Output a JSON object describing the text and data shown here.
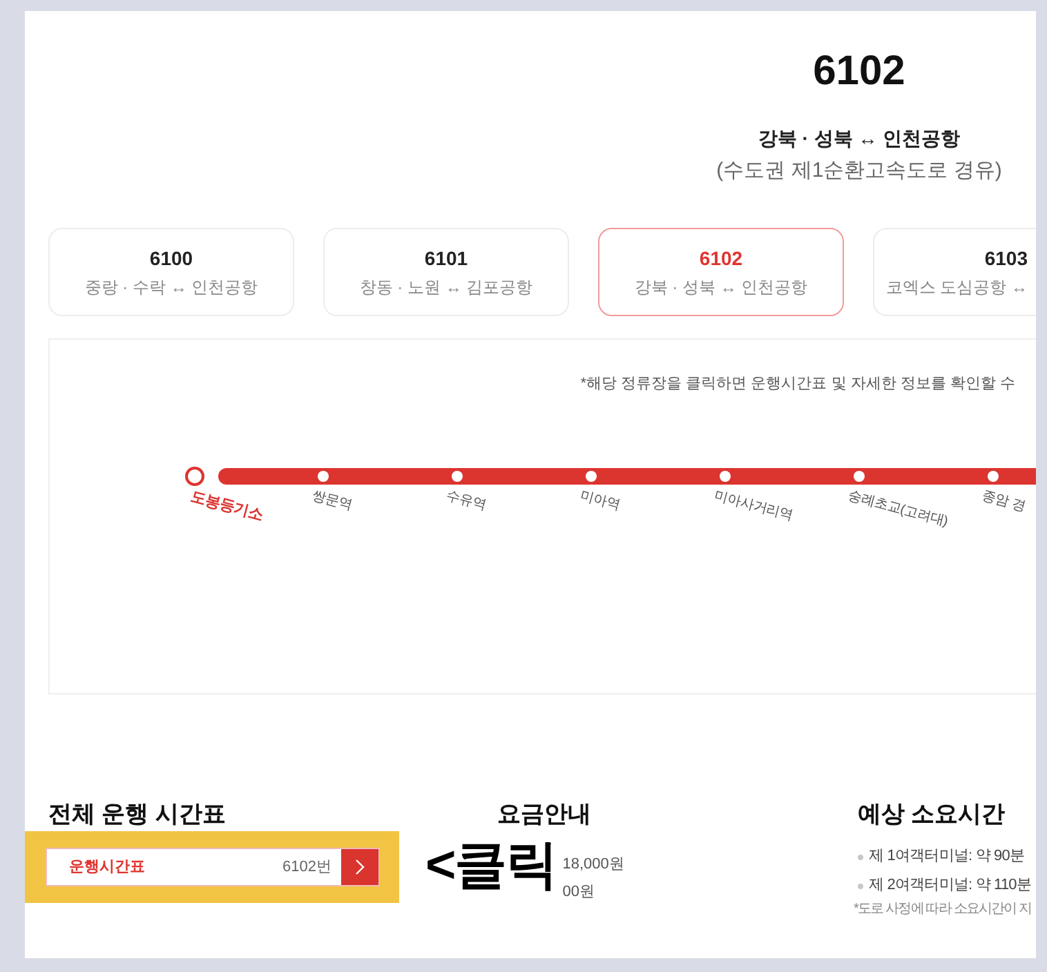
{
  "route": {
    "number": "6102",
    "title": "강북 · 성북 ↔ 인천공항",
    "via": "(수도권 제1순환고속도로 경유)"
  },
  "route_tabs": [
    {
      "number": "6100",
      "name": "중랑 · 수락 ↔ 인천공항",
      "selected": false
    },
    {
      "number": "6101",
      "name": "창동 · 노원 ↔ 김포공항",
      "selected": false
    },
    {
      "number": "6102",
      "name": "강북 · 성북 ↔ 인천공항",
      "selected": true
    },
    {
      "number": "6103",
      "name": "코엑스 도심공항 ↔",
      "selected": false
    }
  ],
  "route_map": {
    "note": "*해당 정류장을 클릭하면 운행시간표 및 자세한 정보를 확인할 수",
    "stops": [
      {
        "name": "도봉등기소",
        "kind": "terminal"
      },
      {
        "name": "쌍문역",
        "kind": "stop"
      },
      {
        "name": "수유역",
        "kind": "stop"
      },
      {
        "name": "미아역",
        "kind": "stop"
      },
      {
        "name": "미아사거리역",
        "kind": "stop"
      },
      {
        "name": "숭례초교(고려대)",
        "kind": "stop"
      },
      {
        "name": "종암 경",
        "kind": "stop"
      }
    ]
  },
  "timetable": {
    "heading": "전체 운행 시간표",
    "button": {
      "label": "운행시간표",
      "route": "6102번"
    }
  },
  "fare": {
    "heading": "요금안내",
    "values": [
      "18,000원",
      "00원"
    ]
  },
  "travel_time": {
    "heading": "예상 소요시간",
    "items": [
      "제 1여객터미널: 약 90분",
      "제 2여객터미널: 약 110분"
    ],
    "note": "*도로 사정에 따라 소요시간이 지"
  },
  "annotation": {
    "text": "<클릭"
  }
}
